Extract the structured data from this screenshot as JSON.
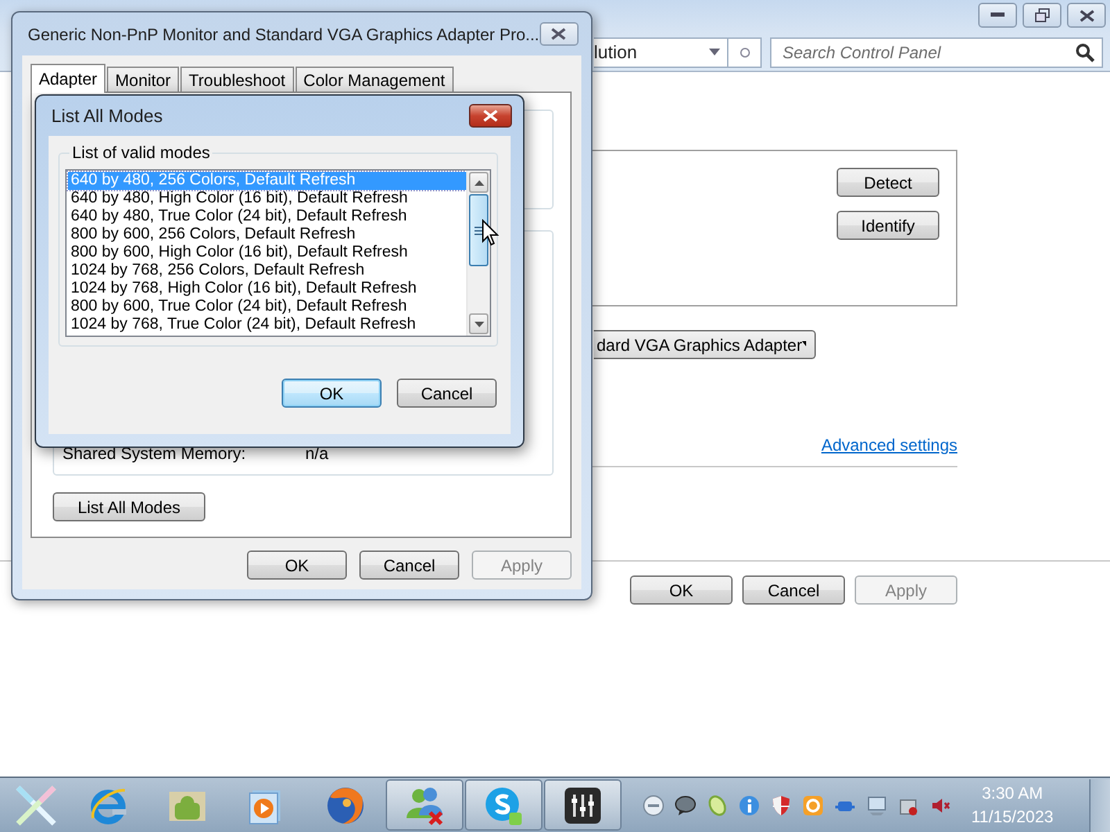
{
  "background_window": {
    "address": "lution",
    "search": {
      "placeholder": "Search Control Panel"
    },
    "side_buttons": [
      "Detect",
      "Identify"
    ],
    "adapter_dropdown": {
      "value": "dard VGA Graphics Adapter"
    },
    "link": "Advanced settings",
    "buttons": [
      {
        "label": "OK",
        "disabled": false
      },
      {
        "label": "Cancel",
        "disabled": false
      },
      {
        "label": "Apply",
        "disabled": true
      }
    ]
  },
  "properties_window": {
    "title": "Generic Non-PnP Monitor and Standard VGA Graphics Adapter Pro...",
    "tabs": [
      {
        "label": "Adapter",
        "selected": true
      },
      {
        "label": "Monitor",
        "selected": false
      },
      {
        "label": "Troubleshoot",
        "selected": false
      },
      {
        "label": "Color Management",
        "selected": false
      }
    ],
    "memory_row": {
      "label": "Shared System Memory:",
      "value": "n/a"
    },
    "list_modes_button": "List All Modes",
    "buttons": [
      {
        "label": "OK",
        "disabled": false
      },
      {
        "label": "Cancel",
        "disabled": false
      },
      {
        "label": "Apply",
        "disabled": true
      }
    ]
  },
  "modes_dialog": {
    "title": "List All Modes",
    "group_label": "List of valid modes",
    "modes": [
      {
        "label": "640 by 480, 256 Colors, Default Refresh",
        "selected": true
      },
      {
        "label": "640 by 480, High Color (16 bit), Default Refresh",
        "selected": false
      },
      {
        "label": "640 by 480, True Color (24 bit), Default Refresh",
        "selected": false
      },
      {
        "label": "800 by 600, 256 Colors, Default Refresh",
        "selected": false
      },
      {
        "label": "800 by 600, High Color (16 bit), Default Refresh",
        "selected": false
      },
      {
        "label": "1024 by 768, 256 Colors, Default Refresh",
        "selected": false
      },
      {
        "label": "1024 by 768, High Color (16 bit), Default Refresh",
        "selected": false
      },
      {
        "label": "800 by 600, True Color (24 bit), Default Refresh",
        "selected": false
      },
      {
        "label": "1024 by 768, True Color (24 bit), Default Refresh",
        "selected": false
      }
    ],
    "buttons": [
      {
        "label": "OK",
        "focused": true
      },
      {
        "label": "Cancel",
        "focused": false
      }
    ]
  },
  "taskbar": {
    "pinned": [
      {
        "kind": "e-browser",
        "active": false
      },
      {
        "kind": "folder",
        "active": false
      },
      {
        "kind": "player",
        "active": false
      },
      {
        "kind": "globe",
        "active": false
      },
      {
        "kind": "people",
        "active": true
      },
      {
        "kind": "chat",
        "active": true
      },
      {
        "kind": "mixer",
        "active": true
      }
    ],
    "clock": {
      "time": "3:30 AM",
      "date": "11/15/2023"
    }
  }
}
